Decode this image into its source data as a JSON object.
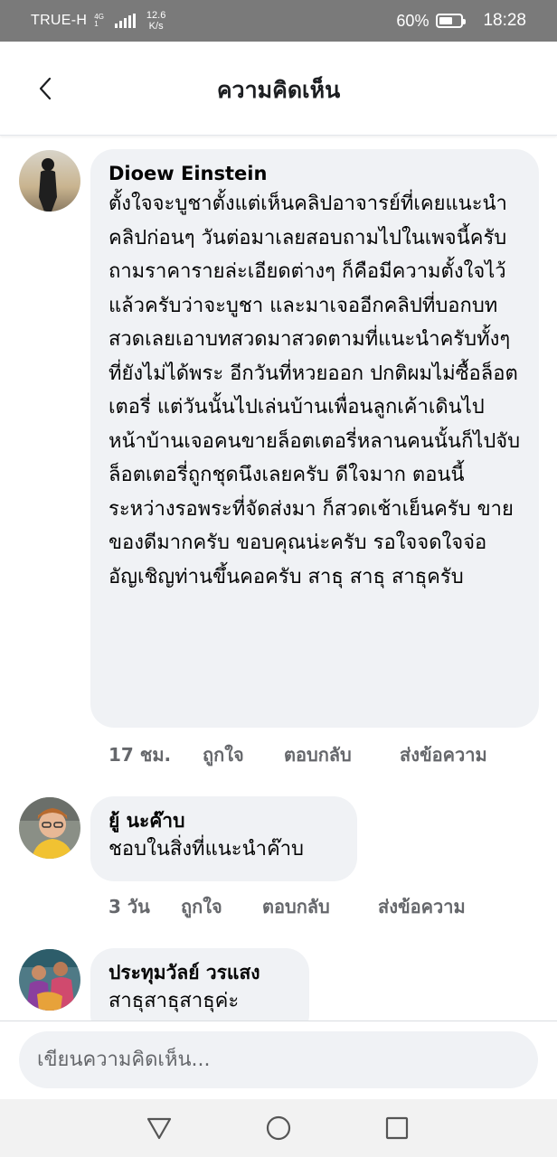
{
  "status_bar": {
    "carrier": "TRUE-H",
    "network_badge_top": "4G",
    "network_badge_bottom": "1",
    "speed_value": "12.6",
    "speed_unit": "K/s",
    "battery_percent": "60%",
    "battery_level": 0.6,
    "time": "18:28"
  },
  "header": {
    "title": "ความคิดเห็น"
  },
  "comments": [
    {
      "author": "Dioew Einstein",
      "text": "ตั้งใจจะบูชาตั้งแต่เห็นคลิปอาจารย์ที่เคยแนะนำคลิปก่อนๆ วันต่อมาเลยสอบถามไปในเพจนี้ครับ ถามราคารายล่ะเอียดต่างๆ ก็คือมีความตั้งใจไว้แล้วครับว่าจะบูชา และมาเจออีกคลิปที่บอกบทสวดเลยเอาบทสวดมาสวดตามที่แนะนำครับทั้งๆที่ยังไม่ได้พระ อีกวันที่หวยออก ปกติผมไม่ซื้อล็อตเตอรี่ แต่วันนั้นไปเล่นบ้านเพื่อนลูกเค้าเดินไปหน้าบ้านเจอคนขายล็อตเตอรี่หลานคนนั้นก็ไปจับล็อตเตอรี่ถูกชุดนึงเลยครับ ดีใจมาก ตอนนี้ระหว่างรอพระที่จัดส่งมา ก็สวดเช้าเย็นครับ ขายของดีมากครับ ขอบคุณน่ะครับ รอใจจดใจจ่ออัญเชิญท่านขึ้นคอครับ สาธุ สาธุ สาธุครับ",
      "time": "17 ชม.",
      "like": "ถูกใจ",
      "reply": "ตอบกลับ",
      "message": "ส่งข้อความ"
    },
    {
      "author": "ยู้ นะค๊าบ",
      "text": "ชอบในสิ่งที่แนะนำค๊าบ",
      "time": "3 วัน",
      "like": "ถูกใจ",
      "reply": "ตอบกลับ",
      "message": "ส่งข้อความ"
    },
    {
      "author": "ประทุมวัลย์ วรแสง",
      "text": "สาธุสาธุสาธุค่ะ"
    }
  ],
  "composer": {
    "placeholder": "เขียนความคิดเห็น..."
  },
  "icons": {
    "back": "back-arrow-icon",
    "nav_back": "triangle-back-icon",
    "nav_home": "circle-home-icon",
    "nav_recents": "square-recents-icon"
  },
  "colors": {
    "bubble": "#f0f2f5",
    "meta_text": "#65676b",
    "status_bar": "#7a7a7a"
  }
}
